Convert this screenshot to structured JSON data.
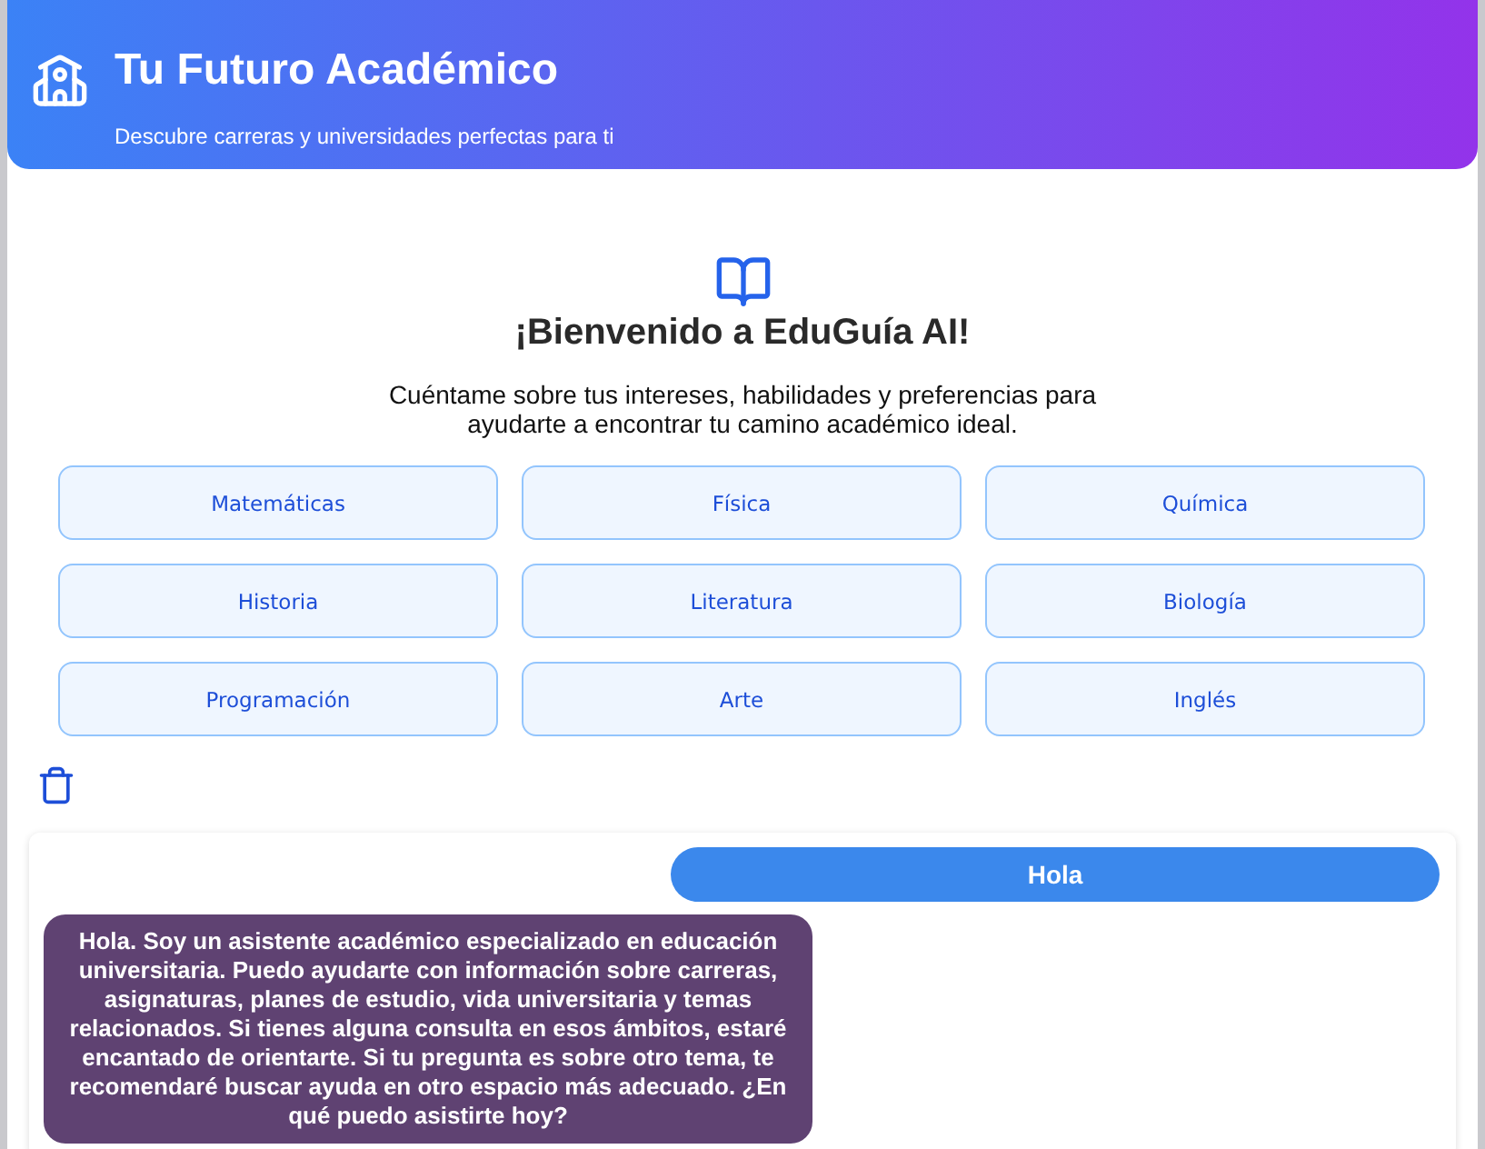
{
  "header": {
    "title": "Tu Futuro Académico",
    "subtitle": "Descubre carreras y universidades perfectas para ti"
  },
  "welcome": {
    "title": "¡Bienvenido a EduGuía AI!",
    "text": "Cuéntame sobre tus intereses, habilidades y preferencias para ayudarte a encontrar tu camino académico ideal."
  },
  "topics": [
    "Matemáticas",
    "Física",
    "Química",
    "Historia",
    "Literatura",
    "Biología",
    "Programación",
    "Arte",
    "Inglés"
  ],
  "chat": {
    "messages": [
      {
        "kind": "user",
        "text": "Hola"
      },
      {
        "kind": "assistant",
        "text": "Hola. Soy un asistente académico especializado en educación universitaria. Puedo ayudarte con información sobre carreras, asignaturas, planes de estudio, vida universitaria y temas relacionados. Si tienes alguna consulta en esos ámbitos, estaré encantado de orientarte. Si tu pregunta es sobre otro tema, te recomendaré buscar ayuda en otro espacio más adecuado. ¿En qué puedo asistirte hoy?"
      }
    ]
  }
}
